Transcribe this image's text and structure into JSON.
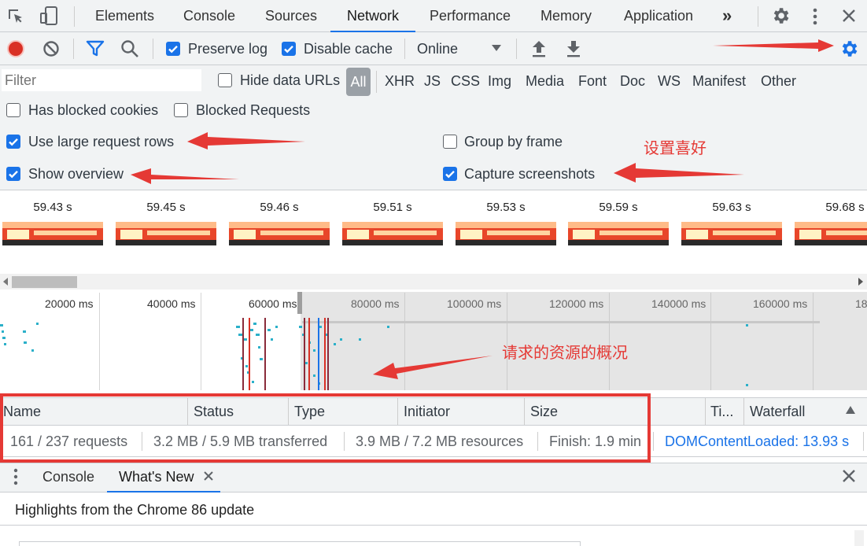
{
  "tabs": [
    "Elements",
    "Console",
    "Sources",
    "Network",
    "Performance",
    "Memory",
    "Application"
  ],
  "active_tab": "Network",
  "overflow_label": "»",
  "toolbar": {
    "preserve_log": "Preserve log",
    "disable_cache": "Disable cache",
    "throttling": "Online"
  },
  "filter": {
    "placeholder": "Filter",
    "hide_data_urls": "Hide data URLs",
    "all": "All",
    "types": [
      "XHR",
      "JS",
      "CSS",
      "Img",
      "Media",
      "Font",
      "Doc",
      "WS",
      "Manifest",
      "Other"
    ]
  },
  "options": {
    "has_blocked_cookies": "Has blocked cookies",
    "blocked_requests": "Blocked Requests",
    "use_large_rows": "Use large request rows",
    "group_by_frame": "Group by frame",
    "show_overview": "Show overview",
    "capture_screenshots": "Capture screenshots"
  },
  "annotations": {
    "preferences": "设置喜好",
    "overview_note": "请求的资源的概况"
  },
  "screenshot_times": [
    "59.43 s",
    "59.45 s",
    "59.46 s",
    "59.51 s",
    "59.53 s",
    "59.59 s",
    "59.63 s",
    "59.68 s"
  ],
  "overview_ticks": [
    "20000 ms",
    "40000 ms",
    "60000 ms",
    "80000 ms",
    "100000 ms",
    "120000 ms",
    "140000 ms",
    "160000 ms",
    "18"
  ],
  "columns": [
    "Name",
    "Status",
    "Type",
    "Initiator",
    "Size",
    "Ti...",
    "Waterfall"
  ],
  "summary": {
    "requests": "161 / 237 requests",
    "transferred": "3.2 MB / 5.9 MB transferred",
    "resources": "3.9 MB / 7.2 MB resources",
    "finish": "Finish: 1.9 min",
    "dcl": "DOMContentLoaded: 13.93 s"
  },
  "drawer": {
    "console": "Console",
    "whats_new": "What's New"
  },
  "highlights": "Highlights from the Chrome 86 update",
  "colors": {
    "accent": "#1a73e8",
    "record": "#d93025",
    "annotation": "#e53935"
  }
}
